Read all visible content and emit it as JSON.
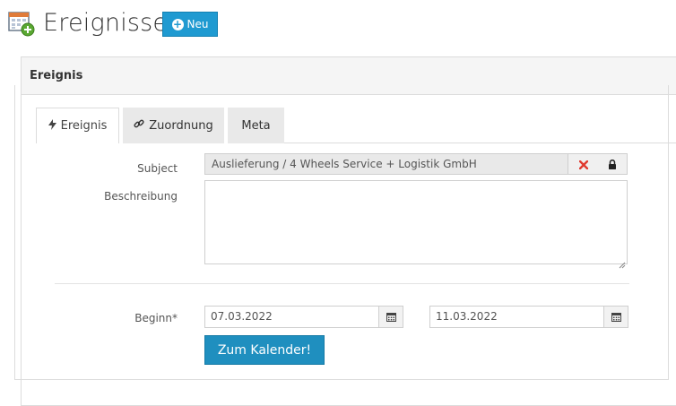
{
  "header": {
    "title": "Ereignisse",
    "new_button": "Neu",
    "icon": "calendar-add-icon"
  },
  "panel": {
    "title": "Ereignis"
  },
  "tabs": [
    {
      "label": "Ereignis",
      "icon": "bolt-icon",
      "active": true
    },
    {
      "label": "Zuordnung",
      "icon": "link-icon",
      "active": false
    },
    {
      "label": "Meta",
      "active": false
    }
  ],
  "form": {
    "subject_label": "Subject",
    "subject_value": "Auslieferung / 4 Wheels Service + Logistik GmbH",
    "description_label": "Beschreibung",
    "description_value": "",
    "begin_label": "Beginn*",
    "begin_date": "07.03.2022",
    "end_date": "11.03.2022",
    "calendar_button": "Zum Kalender!"
  },
  "colors": {
    "accent": "#1f9ad1",
    "clear_icon": "#e03a2f"
  }
}
